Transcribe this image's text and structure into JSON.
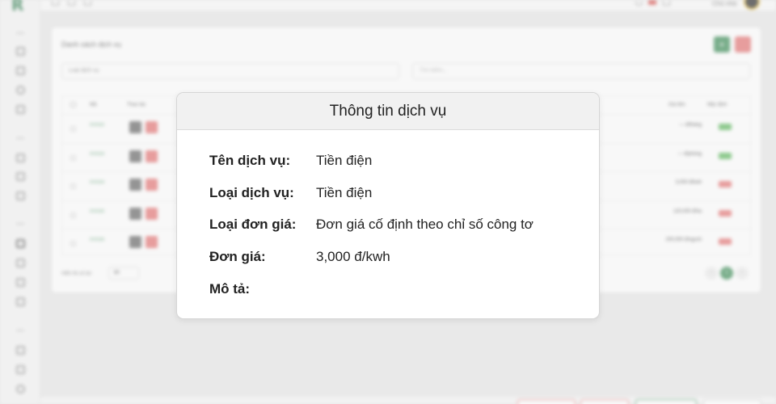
{
  "background": {
    "card_title": "Danh sách dịch vụ",
    "add_label": "+",
    "filter_placeholder": "Loại dịch vụ",
    "search_placeholder": "Tìm kiếm...",
    "columns": [
      "Mã",
      "Thao tác",
      "Giá tiền",
      "Mặc định"
    ],
    "rows": [
      {
        "code": "DV0102",
        "price": "— đ/tháng",
        "status_color": "#5cb85c"
      },
      {
        "code": "DV0103",
        "price": "— đ/phòng",
        "status_color": "#5cb85c"
      },
      {
        "code": "DV0104",
        "price": "3,000 đ/kwh",
        "status_color": "#e57373"
      },
      {
        "code": "DV0105",
        "price": "120,000 đ/ha",
        "status_color": "#e57373"
      },
      {
        "code": "DV0106",
        "price": "200,000 đ/người",
        "status_color": "#e57373"
      }
    ],
    "footer_text": "Hiển thị số dư",
    "page_size": "50",
    "current_page": "1",
    "user_label": "Chủ nhà",
    "accent_color": "#3c8d57"
  },
  "modal": {
    "title": "Thông tin dịch vụ",
    "fields": [
      {
        "label": "Tên dịch vụ:",
        "value": "Tiền điện"
      },
      {
        "label": "Loại dịch vụ:",
        "value": "Tiền điện"
      },
      {
        "label": "Loại đơn giá:",
        "value": "Đơn giá cố định theo chỉ số công tơ"
      },
      {
        "label": "Đơn giá:",
        "value": "3,000 đ/kwh"
      },
      {
        "label": "Mô tả:",
        "value": ""
      }
    ]
  }
}
